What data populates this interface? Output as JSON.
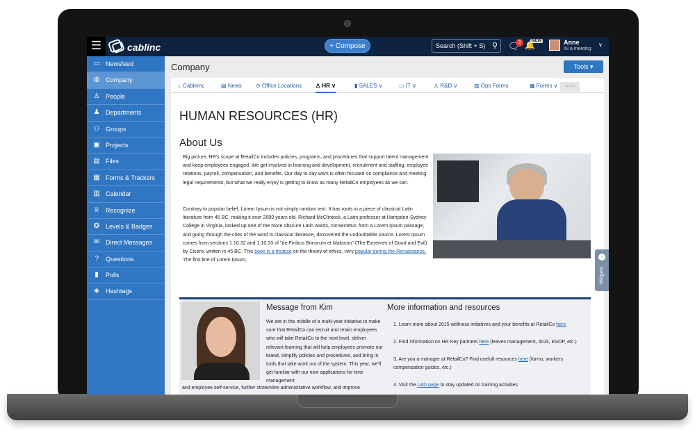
{
  "topbar": {
    "menu_icon": "hamburger-icon",
    "logo_text": "cablinc",
    "compose_label": "+ Compose",
    "search_placeholder": "Search (Shift + S)",
    "chat_badge": "2",
    "new_badge": "NEW",
    "user_name": "Anne",
    "user_status": "IN a meeting"
  },
  "sidebar": {
    "items": [
      {
        "label": "Newsfeed",
        "icon": "newsfeed-icon",
        "glyph": "▭",
        "active": false
      },
      {
        "label": "Company",
        "icon": "globe-icon",
        "glyph": "◍",
        "active": true
      },
      {
        "label": "People",
        "icon": "person-icon",
        "glyph": "♙",
        "active": false
      },
      {
        "label": "Departments",
        "icon": "departments-icon",
        "glyph": "♟",
        "active": false
      },
      {
        "label": "Groups",
        "icon": "groups-icon",
        "glyph": "⚇",
        "active": false
      },
      {
        "label": "Projects",
        "icon": "briefcase-icon",
        "glyph": "▣",
        "active": false
      },
      {
        "label": "Files",
        "icon": "file-icon",
        "glyph": "▤",
        "active": false
      },
      {
        "label": "Forms & Trackers",
        "icon": "grid-icon",
        "glyph": "▦",
        "active": false
      },
      {
        "label": "Calendar",
        "icon": "calendar-icon",
        "glyph": "▥",
        "active": false
      },
      {
        "label": "Recognize",
        "icon": "trophy-icon",
        "glyph": "♕",
        "active": false
      },
      {
        "label": "Levels & Badges",
        "icon": "badge-icon",
        "glyph": "✪",
        "active": false
      },
      {
        "label": "Direct Messages",
        "icon": "message-icon",
        "glyph": "✉",
        "active": false
      },
      {
        "label": "Questions",
        "icon": "question-icon",
        "glyph": "?",
        "active": false
      },
      {
        "label": "Polls",
        "icon": "poll-icon",
        "glyph": "▮",
        "active": false
      },
      {
        "label": "Hashtags",
        "icon": "tag-icon",
        "glyph": "◈",
        "active": false
      }
    ]
  },
  "main": {
    "page_title": "Company",
    "tools_label": "Tools ▾",
    "tabs": [
      {
        "label": "⌂ Cableinc",
        "icon": "home-icon"
      },
      {
        "label": "▤ News",
        "icon": "news-icon"
      },
      {
        "label": "⊙ Office Locations",
        "icon": "location-icon"
      },
      {
        "label": "♙ HR ∨",
        "icon": "hr-icon",
        "active": true
      },
      {
        "label": "▮ SALES ∨",
        "icon": "sales-icon"
      },
      {
        "label": "▭ IT ∨",
        "icon": "monitor-icon"
      },
      {
        "label": "♙ R&D ∨",
        "icon": "rd-icon"
      },
      {
        "label": "▥ Ops Forms",
        "icon": "ops-icon"
      },
      {
        "label": "▦ Forms ∨",
        "icon": "forms-icon"
      }
    ],
    "tab_more": "○○○",
    "heading": "HUMAN RESOURCES (HR)",
    "about_title": "About Us",
    "about_p1": "Big picture, HR's scope at RetailCo includes policies, programs, and procedures that support talent management and keep employees engaged. We get involved in learning and development, recruitment and staffing, employee relations, payroll, compensation, and benefits. Our day to day work is often focused on compliance and meeting legal requirements, but what we really enjoy is getting to know as many RetailCo employees as we can.",
    "about_p2_a": "Contrary to popular belief, Lorem Ipsum is not simply random text. It has roots in a piece of classical Latin literature from 45 BC, making it over 2000 years old. Richard McClintock, a Latin professor at Hampden-Sydney College in Virginia, looked up one of the more obscure Latin words, consectetur, from a Lorem Ipsum passage, and going through the cites of the word in classical literature, discovered the undoubtable source. Lorem Ipsum comes from sections 1.10.32 and 1.10.33 of \"de Finibus Bonorum et Malorum\" (The Extremes of Good and Evil) by Cicero, written in 45 BC. This ",
    "about_p2_link1": "book is a treatise",
    "about_p2_b": " on the theory of ethics, very ",
    "about_p2_link2": "popular during the Renaissance.",
    "about_p2_c": " The first line of Lorem Ipsum,",
    "kim_title": "Message from Kim",
    "kim_text": "We are in the middle of a multi-year initiative to make sure that RetailCo can recruit and retain employees who will take RetailCo to the next level, deliver relevant learning that will help employees promote our brand, simplify policies and procedures, and bring in tools that take work out of the system.  This year, we'll get familiar with our new applications for time management",
    "kim_text2": "and employee self-service, further streamline administrative workflow, and improve",
    "more_title": "More information and resources",
    "more_1": "1. Learn more about 2015 wellness initiatives and your benefits at RetailCo ",
    "more_1_link": "here",
    "more_2": "2. Find information on HR Key partners ",
    "more_2_link": "here",
    "more_2_after": " (leaves management, 401k, ESOP, etc.)",
    "more_3": "3. Are you a manager at RetailCo? Find usefull resources ",
    "more_3_link": "here",
    "more_3_after": " (forms, workers compensation guides, etc.)",
    "more_4": "4. Visit the ",
    "more_4_link": "L&D page",
    "more_4_after": " to stay updated on training activities"
  },
  "widgets_label": "Widgets",
  "colors": {
    "topbar": "#0e2340",
    "sidebar": "#2f76c3",
    "sidebar_active": "#5c97d4",
    "accent": "#3d7fcc",
    "notification": "#e53935"
  }
}
